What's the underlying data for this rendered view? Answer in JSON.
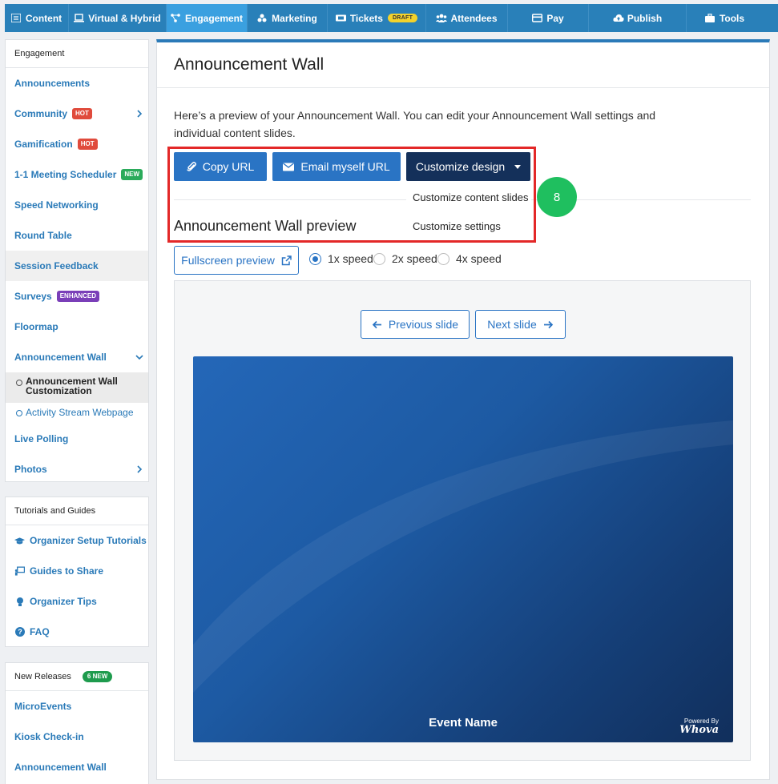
{
  "topnav": {
    "items": [
      {
        "label": "Content",
        "icon": "list-icon"
      },
      {
        "label": "Virtual & Hybrid",
        "icon": "laptop-icon"
      },
      {
        "label": "Engagement",
        "icon": "network-icon"
      },
      {
        "label": "Marketing",
        "icon": "share-icon"
      },
      {
        "label": "Tickets",
        "icon": "ticket-icon",
        "badge": "DRAFT"
      },
      {
        "label": "Attendees",
        "icon": "users-icon"
      },
      {
        "label": "Pay",
        "icon": "card-icon"
      },
      {
        "label": "Publish",
        "icon": "cloud-upload-icon"
      },
      {
        "label": "Tools",
        "icon": "toolbox-icon"
      }
    ]
  },
  "sidebar": {
    "engagement": {
      "header": "Engagement",
      "items": [
        {
          "label": "Announcements"
        },
        {
          "label": "Community",
          "badge": "HOT"
        },
        {
          "label": "Gamification",
          "badge": "HOT"
        },
        {
          "label": "1-1 Meeting Scheduler",
          "badge": "NEW"
        },
        {
          "label": "Speed Networking"
        },
        {
          "label": "Round Table"
        },
        {
          "label": "Session Feedback"
        },
        {
          "label": "Surveys",
          "badge": "ENHANCED"
        },
        {
          "label": "Floormap"
        },
        {
          "label": "Announcement Wall"
        },
        {
          "label": "Live Polling"
        },
        {
          "label": "Photos"
        }
      ],
      "sub_items": [
        {
          "label": "Announcement Wall Customization"
        },
        {
          "label": "Activity Stream Webpage"
        }
      ]
    },
    "tutorials": {
      "header": "Tutorials and Guides",
      "items": [
        {
          "label": "Organizer Setup Tutorials",
          "icon": "graduation-cap-icon"
        },
        {
          "label": "Guides to Share",
          "icon": "presentation-icon"
        },
        {
          "label": "Organizer Tips",
          "icon": "lightbulb-icon"
        },
        {
          "label": "FAQ",
          "icon": "question-circle-icon"
        }
      ]
    },
    "releases": {
      "header": "New Releases",
      "badge": "6 NEW",
      "items": [
        {
          "label": "MicroEvents"
        },
        {
          "label": "Kiosk Check-in"
        },
        {
          "label": "Announcement Wall"
        }
      ]
    }
  },
  "main": {
    "title": "Announcement Wall",
    "intro": "Here’s a preview of your Announcement Wall. You can edit your Announcement Wall settings and individual content slides.",
    "buttons": {
      "copy_url": "Copy URL",
      "email_url": "Email myself URL",
      "customize": "Customize design"
    },
    "dropdown": [
      "Customize content slides",
      "Customize settings"
    ],
    "step_number": "8",
    "preview_title": "Announcement Wall preview",
    "fullscreen": "Fullscreen preview",
    "speeds": [
      {
        "label": "1x speed",
        "selected": true
      },
      {
        "label": "2x speed",
        "selected": false
      },
      {
        "label": "4x speed",
        "selected": false
      }
    ],
    "prev_slide": "Previous slide",
    "next_slide": "Next slide",
    "slide": {
      "event_name": "Event Name",
      "powered_by": "Powered By",
      "brand": "Whova"
    }
  },
  "colors": {
    "nav_bg": "#2980b9",
    "nav_active": "#3aa0e0",
    "accent_blue": "#2a74c4",
    "dark_button": "#14305a",
    "highlight_red": "#e32828",
    "step_green": "#1fbf5f"
  }
}
